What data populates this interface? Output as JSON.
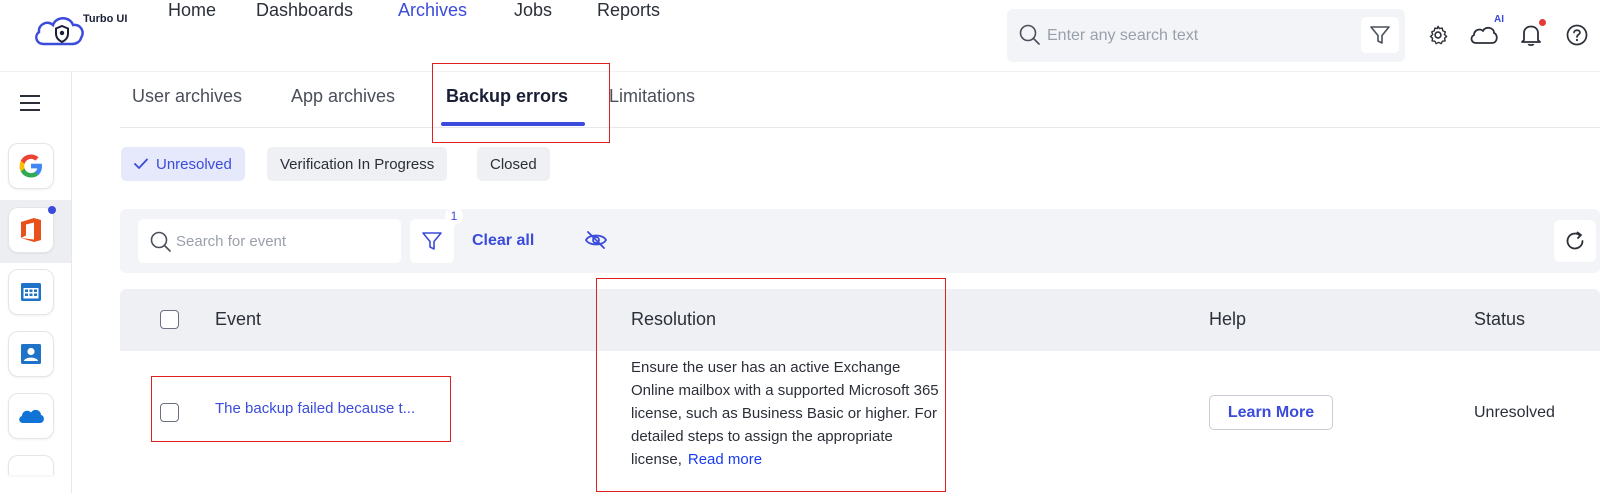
{
  "app": {
    "name": "Turbo UI"
  },
  "nav": {
    "items": [
      {
        "label": "Home",
        "active": false
      },
      {
        "label": "Dashboards",
        "active": false
      },
      {
        "label": "Archives",
        "active": true
      },
      {
        "label": "Jobs",
        "active": false
      },
      {
        "label": "Reports",
        "active": false
      }
    ]
  },
  "top_search": {
    "placeholder": "Enter any search text"
  },
  "top_icons": {
    "ai_label": "AI"
  },
  "tabs": [
    {
      "label": "User archives",
      "active": false
    },
    {
      "label": "App archives",
      "active": false
    },
    {
      "label": "Backup errors",
      "active": true
    },
    {
      "label": "Limitations",
      "active": false
    }
  ],
  "status_chips": [
    {
      "label": "Unresolved",
      "selected": true
    },
    {
      "label": "Verification In Progress",
      "selected": false
    },
    {
      "label": "Closed",
      "selected": false
    }
  ],
  "filter_bar": {
    "search_placeholder": "Search for event",
    "filter_count": "1",
    "clear_all_label": "Clear all"
  },
  "table": {
    "columns": [
      "Event",
      "Resolution",
      "Help",
      "Status"
    ],
    "rows": [
      {
        "event": "The backup failed because t...",
        "resolution": "Ensure the user has an active Exchange Online mailbox with a supported Microsoft 365 license, such as Business Basic or higher. For detailed steps to assign the appropriate license,",
        "read_more": "Read more",
        "help_label": "Learn More",
        "status": "Unresolved"
      }
    ]
  },
  "colors": {
    "accent": "#3b4bdb",
    "highlight": "#e02020",
    "notification": "#e53935"
  }
}
